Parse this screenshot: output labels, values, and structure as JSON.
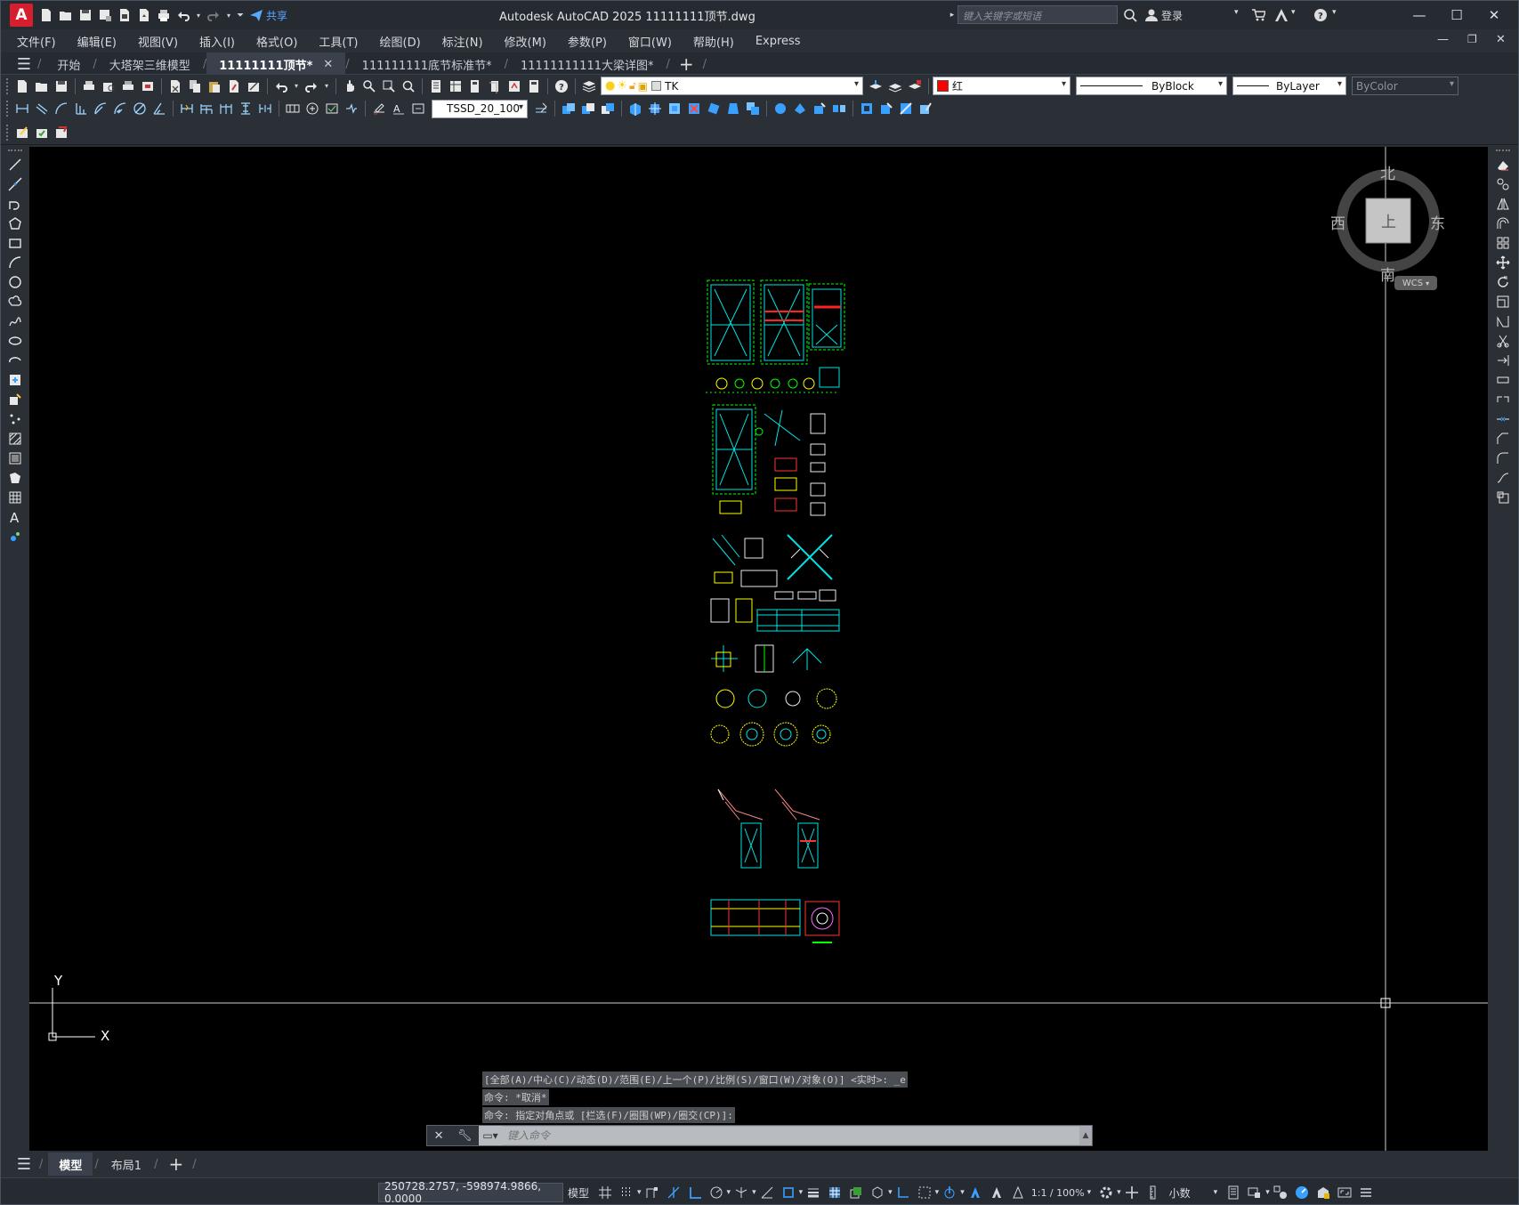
{
  "titlebar": {
    "logo": "A",
    "share": "共享",
    "app_title": "Autodesk AutoCAD 2025    11111111顶节.dwg",
    "search_placeholder": "键入关键字或短语",
    "login": "登录"
  },
  "menus": [
    "文件(F)",
    "编辑(E)",
    "视图(V)",
    "插入(I)",
    "格式(O)",
    "工具(T)",
    "绘图(D)",
    "标注(N)",
    "修改(M)",
    "参数(P)",
    "窗口(W)",
    "帮助(H)",
    "Express"
  ],
  "tabs": [
    {
      "label": "开始",
      "active": false
    },
    {
      "label": "大塔架三维模型",
      "active": false
    },
    {
      "label": "11111111顶节*",
      "active": true,
      "closable": true
    },
    {
      "label": "111111111底节标准节*",
      "active": false
    },
    {
      "label": "11111111111大梁详图*",
      "active": false
    }
  ],
  "toolbar": {
    "layer": "TK",
    "color": "红",
    "color_hex": "#ff0000",
    "linetype": "ByBlock",
    "lineweight": "ByLayer",
    "plotstyle": "ByColor",
    "text_style": "TSSD_20_100"
  },
  "viewcube": {
    "north": "北",
    "south": "南",
    "east": "东",
    "west": "西",
    "face": "上",
    "wcs": "WCS"
  },
  "ucs": {
    "x": "X",
    "y": "Y"
  },
  "command": {
    "history": [
      "[全部(A)/中心(C)/动态(D)/范围(E)/上一个(P)/比例(S)/窗口(W)/对象(O)] <实时>: _e",
      "命令: *取消*",
      "命令: 指定对角点或 [栏选(F)/圈围(WP)/圈交(CP)]:"
    ],
    "placeholder": "键入命令"
  },
  "layout_tabs": [
    {
      "label": "模型",
      "active": true
    },
    {
      "label": "布局1",
      "active": false
    }
  ],
  "status": {
    "coords": "250728.2757, -598974.9866, 0.0000",
    "model": "模型",
    "scale": "1:1 / 100%",
    "units": "小数"
  }
}
